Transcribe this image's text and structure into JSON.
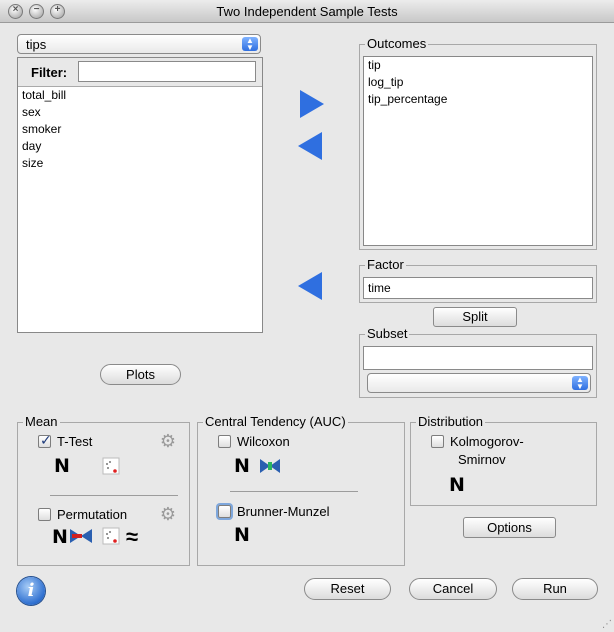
{
  "window": {
    "title": "Two Independent Sample Tests"
  },
  "dataset": {
    "selected": "tips",
    "filter_label": "Filter:",
    "filter_value": "",
    "variables": [
      "total_bill",
      "sex",
      "smoker",
      "day",
      "size"
    ]
  },
  "outcomes": {
    "label": "Outcomes",
    "items": [
      "tip",
      "log_tip",
      "tip_percentage"
    ]
  },
  "factor": {
    "label": "Factor",
    "value": "time",
    "split_label": "Split"
  },
  "subset": {
    "label": "Subset",
    "value": "",
    "selected": ""
  },
  "plots_label": "Plots",
  "mean": {
    "label": "Mean",
    "ttest": {
      "label": "T-Test",
      "checked": true
    },
    "permutation": {
      "label": "Permutation",
      "checked": false
    }
  },
  "central": {
    "label": "Central Tendency (AUC)",
    "wilcoxon": {
      "label": "Wilcoxon",
      "checked": false
    },
    "brunner": {
      "label": "Brunner-Munzel",
      "checked": false
    }
  },
  "distribution": {
    "label": "Distribution",
    "ks": {
      "label_line1": "Kolmogorov-",
      "label_line2": "Smirnov",
      "checked": false
    }
  },
  "options_label": "Options",
  "buttons": {
    "reset": "Reset",
    "cancel": "Cancel",
    "run": "Run"
  },
  "icons": {
    "normal_glyph": "N",
    "approx_glyph": "≈",
    "gear_glyph": "⚙",
    "info_glyph": "i",
    "check_glyph": "✓",
    "close_glyph": "×",
    "minimize_glyph": "−",
    "zoom_glyph": "+"
  },
  "colors": {
    "accent": "#2f6fe0"
  }
}
